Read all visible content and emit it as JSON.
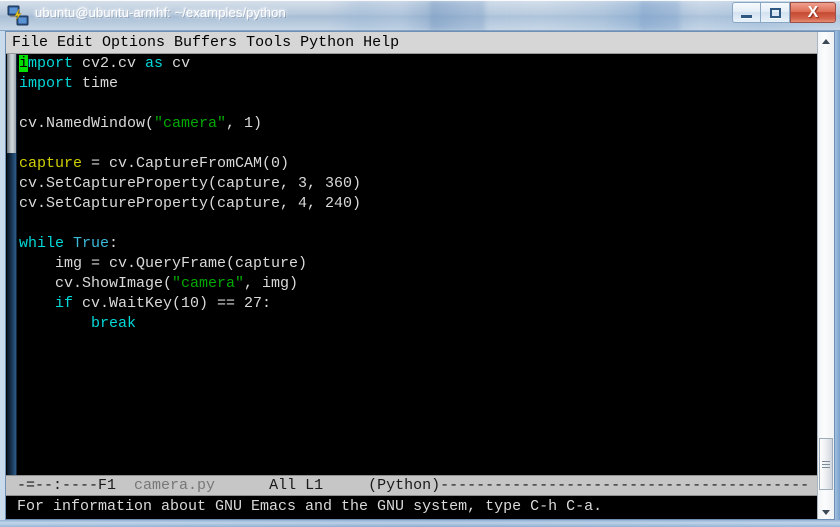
{
  "window": {
    "title": "ubuntu@ubuntu-armhf: ~/examples/python",
    "icon": "putty-terminal-icon",
    "controls": {
      "minimize_label": "–",
      "maximize_label": "□",
      "close_label": "X"
    }
  },
  "menubar": {
    "items": [
      {
        "label": "File"
      },
      {
        "label": "Edit"
      },
      {
        "label": "Options"
      },
      {
        "label": "Buffers"
      },
      {
        "label": "Tools"
      },
      {
        "label": "Python"
      },
      {
        "label": "Help"
      }
    ]
  },
  "editor": {
    "cursor_char": "i",
    "lines": [
      {
        "id": 1,
        "segments": [
          {
            "text": "i",
            "type": "cursor"
          },
          {
            "text": "mport",
            "type": "keyword"
          },
          {
            "text": " cv2.cv ",
            "type": "plain"
          },
          {
            "text": "as",
            "type": "keyword"
          },
          {
            "text": " cv",
            "type": "plain"
          }
        ]
      },
      {
        "id": 2,
        "segments": [
          {
            "text": "import",
            "type": "keyword"
          },
          {
            "text": " time",
            "type": "plain"
          }
        ]
      },
      {
        "id": 3,
        "segments": []
      },
      {
        "id": 4,
        "segments": [
          {
            "text": "cv.NamedWindow(",
            "type": "plain"
          },
          {
            "text": "\"camera\"",
            "type": "string"
          },
          {
            "text": ", 1)",
            "type": "plain"
          }
        ]
      },
      {
        "id": 5,
        "segments": []
      },
      {
        "id": 6,
        "segments": [
          {
            "text": "capture",
            "type": "variable"
          },
          {
            "text": " = cv.CaptureFromCAM(0)",
            "type": "plain"
          }
        ]
      },
      {
        "id": 7,
        "segments": [
          {
            "text": "cv.SetCaptureProperty(capture, 3, 360)",
            "type": "plain"
          }
        ]
      },
      {
        "id": 8,
        "segments": [
          {
            "text": "cv.SetCaptureProperty(capture, 4, 240)",
            "type": "plain"
          }
        ]
      },
      {
        "id": 9,
        "segments": []
      },
      {
        "id": 10,
        "segments": [
          {
            "text": "while",
            "type": "keyword"
          },
          {
            "text": " ",
            "type": "plain"
          },
          {
            "text": "True",
            "type": "builtin"
          },
          {
            "text": ":",
            "type": "plain"
          }
        ]
      },
      {
        "id": 11,
        "segments": [
          {
            "text": "    img = cv.QueryFrame(capture)",
            "type": "plain"
          }
        ]
      },
      {
        "id": 12,
        "segments": [
          {
            "text": "    cv.ShowImage(",
            "type": "plain"
          },
          {
            "text": "\"camera\"",
            "type": "string"
          },
          {
            "text": ", img)",
            "type": "plain"
          }
        ]
      },
      {
        "id": 13,
        "segments": [
          {
            "text": "    ",
            "type": "plain"
          },
          {
            "text": "if",
            "type": "keyword"
          },
          {
            "text": " cv.WaitKey(10) == 27:",
            "type": "plain"
          }
        ]
      },
      {
        "id": 14,
        "segments": [
          {
            "text": "        ",
            "type": "plain"
          },
          {
            "text": "break",
            "type": "keyword"
          }
        ]
      }
    ]
  },
  "modeline": {
    "flags": "-=--:----F1",
    "gap1": "  ",
    "buffer_name": "camera.py",
    "gap2": "      ",
    "position": "All L1",
    "gap3": "     ",
    "major_mode": "(Python)",
    "filler": "-----------------------------------------"
  },
  "echo_area": {
    "message": "For information about GNU Emacs and the GNU system, type C-h C-a."
  },
  "colors": {
    "background": "#000000",
    "foreground": "#d9d9d9",
    "keyword": "#00d7d7",
    "builtin": "#3bb9d9",
    "string": "#00a800",
    "variable": "#cfcf00",
    "cursor": "#00e000",
    "modeline_bg": "#c6c6c6",
    "menubar_bg": "#d6d6d6"
  }
}
